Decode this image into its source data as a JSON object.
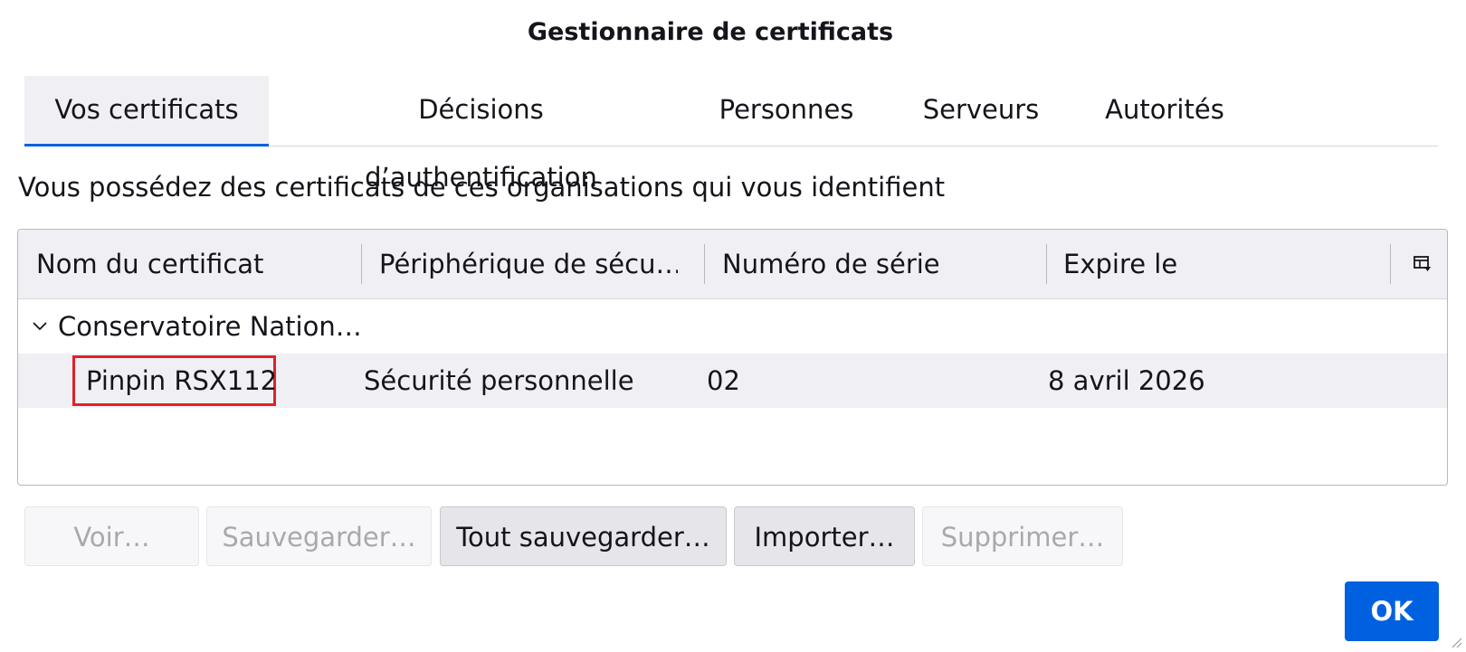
{
  "dialog": {
    "title": "Gestionnaire de certificats"
  },
  "tabs": [
    {
      "label": "Vos certificats",
      "active": true
    },
    {
      "label": "Décisions d’authentification",
      "active": false
    },
    {
      "label": "Personnes",
      "active": false
    },
    {
      "label": "Serveurs",
      "active": false
    },
    {
      "label": "Autorités",
      "active": false
    }
  ],
  "description": "Vous possédez des certificats de ces organisations qui vous identifient",
  "table": {
    "columns": [
      "Nom du certificat",
      "Périphérique de sécu…",
      "Numéro de série",
      "Expire le"
    ],
    "picker_icon": "column-picker-icon",
    "group": {
      "label": "Conservatoire Nation…",
      "expanded": true,
      "icon": "chevron-down-icon"
    },
    "rows": [
      {
        "name": "Pinpin RSX112",
        "device": "Sécurité personnelle",
        "serial": "02",
        "expires": "8 avril 2026"
      }
    ]
  },
  "buttons": {
    "view": "Voir…",
    "backup": "Sauvegarder…",
    "backup_all": "Tout sauvegarder…",
    "import": "Importer…",
    "delete": "Supprimer…",
    "ok": "OK"
  },
  "colors": {
    "accent": "#0061e0",
    "highlight": "#e0202a"
  }
}
